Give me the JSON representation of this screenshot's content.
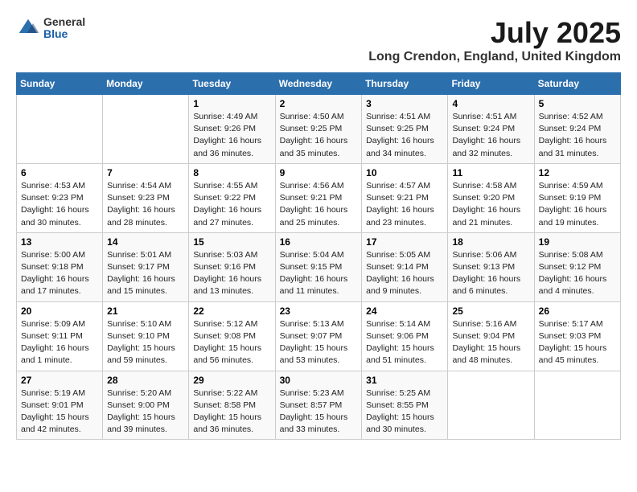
{
  "logo": {
    "general": "General",
    "blue": "Blue"
  },
  "title": "July 2025",
  "location": "Long Crendon, England, United Kingdom",
  "days_header": [
    "Sunday",
    "Monday",
    "Tuesday",
    "Wednesday",
    "Thursday",
    "Friday",
    "Saturday"
  ],
  "weeks": [
    [
      {
        "day": "",
        "info": ""
      },
      {
        "day": "",
        "info": ""
      },
      {
        "day": "1",
        "info": "Sunrise: 4:49 AM\nSunset: 9:26 PM\nDaylight: 16 hours\nand 36 minutes."
      },
      {
        "day": "2",
        "info": "Sunrise: 4:50 AM\nSunset: 9:25 PM\nDaylight: 16 hours\nand 35 minutes."
      },
      {
        "day": "3",
        "info": "Sunrise: 4:51 AM\nSunset: 9:25 PM\nDaylight: 16 hours\nand 34 minutes."
      },
      {
        "day": "4",
        "info": "Sunrise: 4:51 AM\nSunset: 9:24 PM\nDaylight: 16 hours\nand 32 minutes."
      },
      {
        "day": "5",
        "info": "Sunrise: 4:52 AM\nSunset: 9:24 PM\nDaylight: 16 hours\nand 31 minutes."
      }
    ],
    [
      {
        "day": "6",
        "info": "Sunrise: 4:53 AM\nSunset: 9:23 PM\nDaylight: 16 hours\nand 30 minutes."
      },
      {
        "day": "7",
        "info": "Sunrise: 4:54 AM\nSunset: 9:23 PM\nDaylight: 16 hours\nand 28 minutes."
      },
      {
        "day": "8",
        "info": "Sunrise: 4:55 AM\nSunset: 9:22 PM\nDaylight: 16 hours\nand 27 minutes."
      },
      {
        "day": "9",
        "info": "Sunrise: 4:56 AM\nSunset: 9:21 PM\nDaylight: 16 hours\nand 25 minutes."
      },
      {
        "day": "10",
        "info": "Sunrise: 4:57 AM\nSunset: 9:21 PM\nDaylight: 16 hours\nand 23 minutes."
      },
      {
        "day": "11",
        "info": "Sunrise: 4:58 AM\nSunset: 9:20 PM\nDaylight: 16 hours\nand 21 minutes."
      },
      {
        "day": "12",
        "info": "Sunrise: 4:59 AM\nSunset: 9:19 PM\nDaylight: 16 hours\nand 19 minutes."
      }
    ],
    [
      {
        "day": "13",
        "info": "Sunrise: 5:00 AM\nSunset: 9:18 PM\nDaylight: 16 hours\nand 17 minutes."
      },
      {
        "day": "14",
        "info": "Sunrise: 5:01 AM\nSunset: 9:17 PM\nDaylight: 16 hours\nand 15 minutes."
      },
      {
        "day": "15",
        "info": "Sunrise: 5:03 AM\nSunset: 9:16 PM\nDaylight: 16 hours\nand 13 minutes."
      },
      {
        "day": "16",
        "info": "Sunrise: 5:04 AM\nSunset: 9:15 PM\nDaylight: 16 hours\nand 11 minutes."
      },
      {
        "day": "17",
        "info": "Sunrise: 5:05 AM\nSunset: 9:14 PM\nDaylight: 16 hours\nand 9 minutes."
      },
      {
        "day": "18",
        "info": "Sunrise: 5:06 AM\nSunset: 9:13 PM\nDaylight: 16 hours\nand 6 minutes."
      },
      {
        "day": "19",
        "info": "Sunrise: 5:08 AM\nSunset: 9:12 PM\nDaylight: 16 hours\nand 4 minutes."
      }
    ],
    [
      {
        "day": "20",
        "info": "Sunrise: 5:09 AM\nSunset: 9:11 PM\nDaylight: 16 hours\nand 1 minute."
      },
      {
        "day": "21",
        "info": "Sunrise: 5:10 AM\nSunset: 9:10 PM\nDaylight: 15 hours\nand 59 minutes."
      },
      {
        "day": "22",
        "info": "Sunrise: 5:12 AM\nSunset: 9:08 PM\nDaylight: 15 hours\nand 56 minutes."
      },
      {
        "day": "23",
        "info": "Sunrise: 5:13 AM\nSunset: 9:07 PM\nDaylight: 15 hours\nand 53 minutes."
      },
      {
        "day": "24",
        "info": "Sunrise: 5:14 AM\nSunset: 9:06 PM\nDaylight: 15 hours\nand 51 minutes."
      },
      {
        "day": "25",
        "info": "Sunrise: 5:16 AM\nSunset: 9:04 PM\nDaylight: 15 hours\nand 48 minutes."
      },
      {
        "day": "26",
        "info": "Sunrise: 5:17 AM\nSunset: 9:03 PM\nDaylight: 15 hours\nand 45 minutes."
      }
    ],
    [
      {
        "day": "27",
        "info": "Sunrise: 5:19 AM\nSunset: 9:01 PM\nDaylight: 15 hours\nand 42 minutes."
      },
      {
        "day": "28",
        "info": "Sunrise: 5:20 AM\nSunset: 9:00 PM\nDaylight: 15 hours\nand 39 minutes."
      },
      {
        "day": "29",
        "info": "Sunrise: 5:22 AM\nSunset: 8:58 PM\nDaylight: 15 hours\nand 36 minutes."
      },
      {
        "day": "30",
        "info": "Sunrise: 5:23 AM\nSunset: 8:57 PM\nDaylight: 15 hours\nand 33 minutes."
      },
      {
        "day": "31",
        "info": "Sunrise: 5:25 AM\nSunset: 8:55 PM\nDaylight: 15 hours\nand 30 minutes."
      },
      {
        "day": "",
        "info": ""
      },
      {
        "day": "",
        "info": ""
      }
    ]
  ]
}
